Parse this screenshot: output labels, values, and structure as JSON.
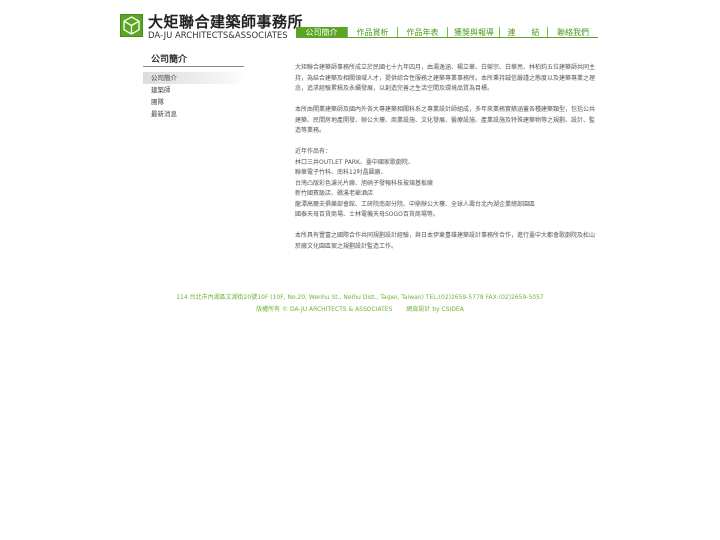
{
  "header": {
    "logo_cn": "大矩聯合建築師事務所",
    "logo_en": "DA-JU ARCHITECTS&ASSOCIATES",
    "logo_icon": "cube-logo-icon"
  },
  "nav": [
    {
      "label": "公司簡介",
      "active": true
    },
    {
      "label": "作品賞析",
      "active": false
    },
    {
      "label": "作品年表",
      "active": false
    },
    {
      "label": "獲獎與報導",
      "active": false
    },
    {
      "label": "連　　結",
      "active": false
    },
    {
      "label": "聯絡我們",
      "active": false
    }
  ],
  "sidebar": {
    "title": "公司簡介",
    "items": [
      {
        "label": "公司簡介",
        "active": true
      },
      {
        "label": "建築師",
        "active": false
      },
      {
        "label": "團隊",
        "active": false
      },
      {
        "label": "最新消息",
        "active": false
      }
    ]
  },
  "content": {
    "para1": "大矩聯合建築師事務所成立於民國七十九年四月，由湯逸涵、楊立華、白榮宗、白華亮、林柏鈞五位建築師共同主持，為結合建築及相關領域人才，提供綜合性服務之建築專業事務所。本所秉持誠信嚴謹之態度以及建築專業之理念，追求經驗累積及永續發展，以創造完善之生活空間及環境品質為目標。",
    "para2": "本所由開業建築師及國內外各大專建築相關科系之專業設計師組成，多年來業務實績涵蓋各種建築類型，包括公共建築、民間房地產開發、辦公大樓、商業設施、文化發展、醫療設施、產業設施及特殊建築物等之規劃、設計、監造等業務。",
    "works_title": "近年作品有：",
    "works": [
      "林口三井OUTLET PARK、臺中國家歌劇院、",
      "聯華電子竹科、南科12吋晶圓廠、",
      "台灣凸版彩色濾光片廠、旭硝子發報科技玻璃基板廠",
      "新竹國賓飯店、礁溪老爺酒店",
      "龍潭高爾夫俱樂部會館、工研院南部分院、中鼎辦公大樓、全球人壽台北內湖企業總部園區",
      "國泰天母百貨商場、士林電機天母SOGO百貨商場等。"
    ],
    "para3": "本所具有豐富之國際合作共同規劃設計經驗，與日本伊東豊雄建築設計事務所合作，進行臺中大都會歌劇院及松山菸廠文化園區案之規劃設計監造工作。"
  },
  "footer": {
    "address": "114 台北市內湖區文湖街20號10F (10F, No.20, Wenhu St., Neihu Dist., Taipei, Taiwan) TEL:(02)2659-5778 FAX:(02)2659-5057",
    "copyright": "版權所有 © DA-JU ARCHITECTS & ASSOCIATES",
    "credit": "網頁設計 by CSIDEA"
  },
  "colors": {
    "brand_green": "#5aa624",
    "footer_green": "#6cb43a"
  }
}
